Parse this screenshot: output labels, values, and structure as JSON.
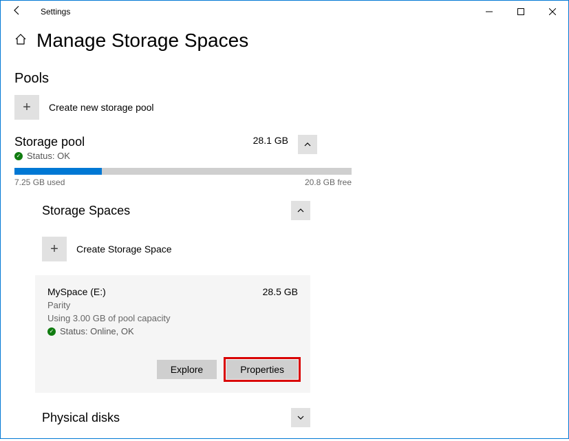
{
  "titlebar": {
    "title": "Settings"
  },
  "page": {
    "title": "Manage Storage Spaces"
  },
  "pools": {
    "heading": "Pools",
    "create_label": "Create new storage pool",
    "name": "Storage pool",
    "status": "Status: OK",
    "total": "28.1 GB",
    "used_label": "7.25 GB used",
    "free_label": "20.8 GB free"
  },
  "spaces": {
    "heading": "Storage Spaces",
    "create_label": "Create Storage Space",
    "item": {
      "name": "MySpace (E:)",
      "size": "28.5 GB",
      "type": "Parity",
      "capacity": "Using 3.00 GB of pool capacity",
      "status": "Status: Online, OK"
    },
    "explore_btn": "Explore",
    "properties_btn": "Properties"
  },
  "physical": {
    "heading": "Physical disks"
  }
}
